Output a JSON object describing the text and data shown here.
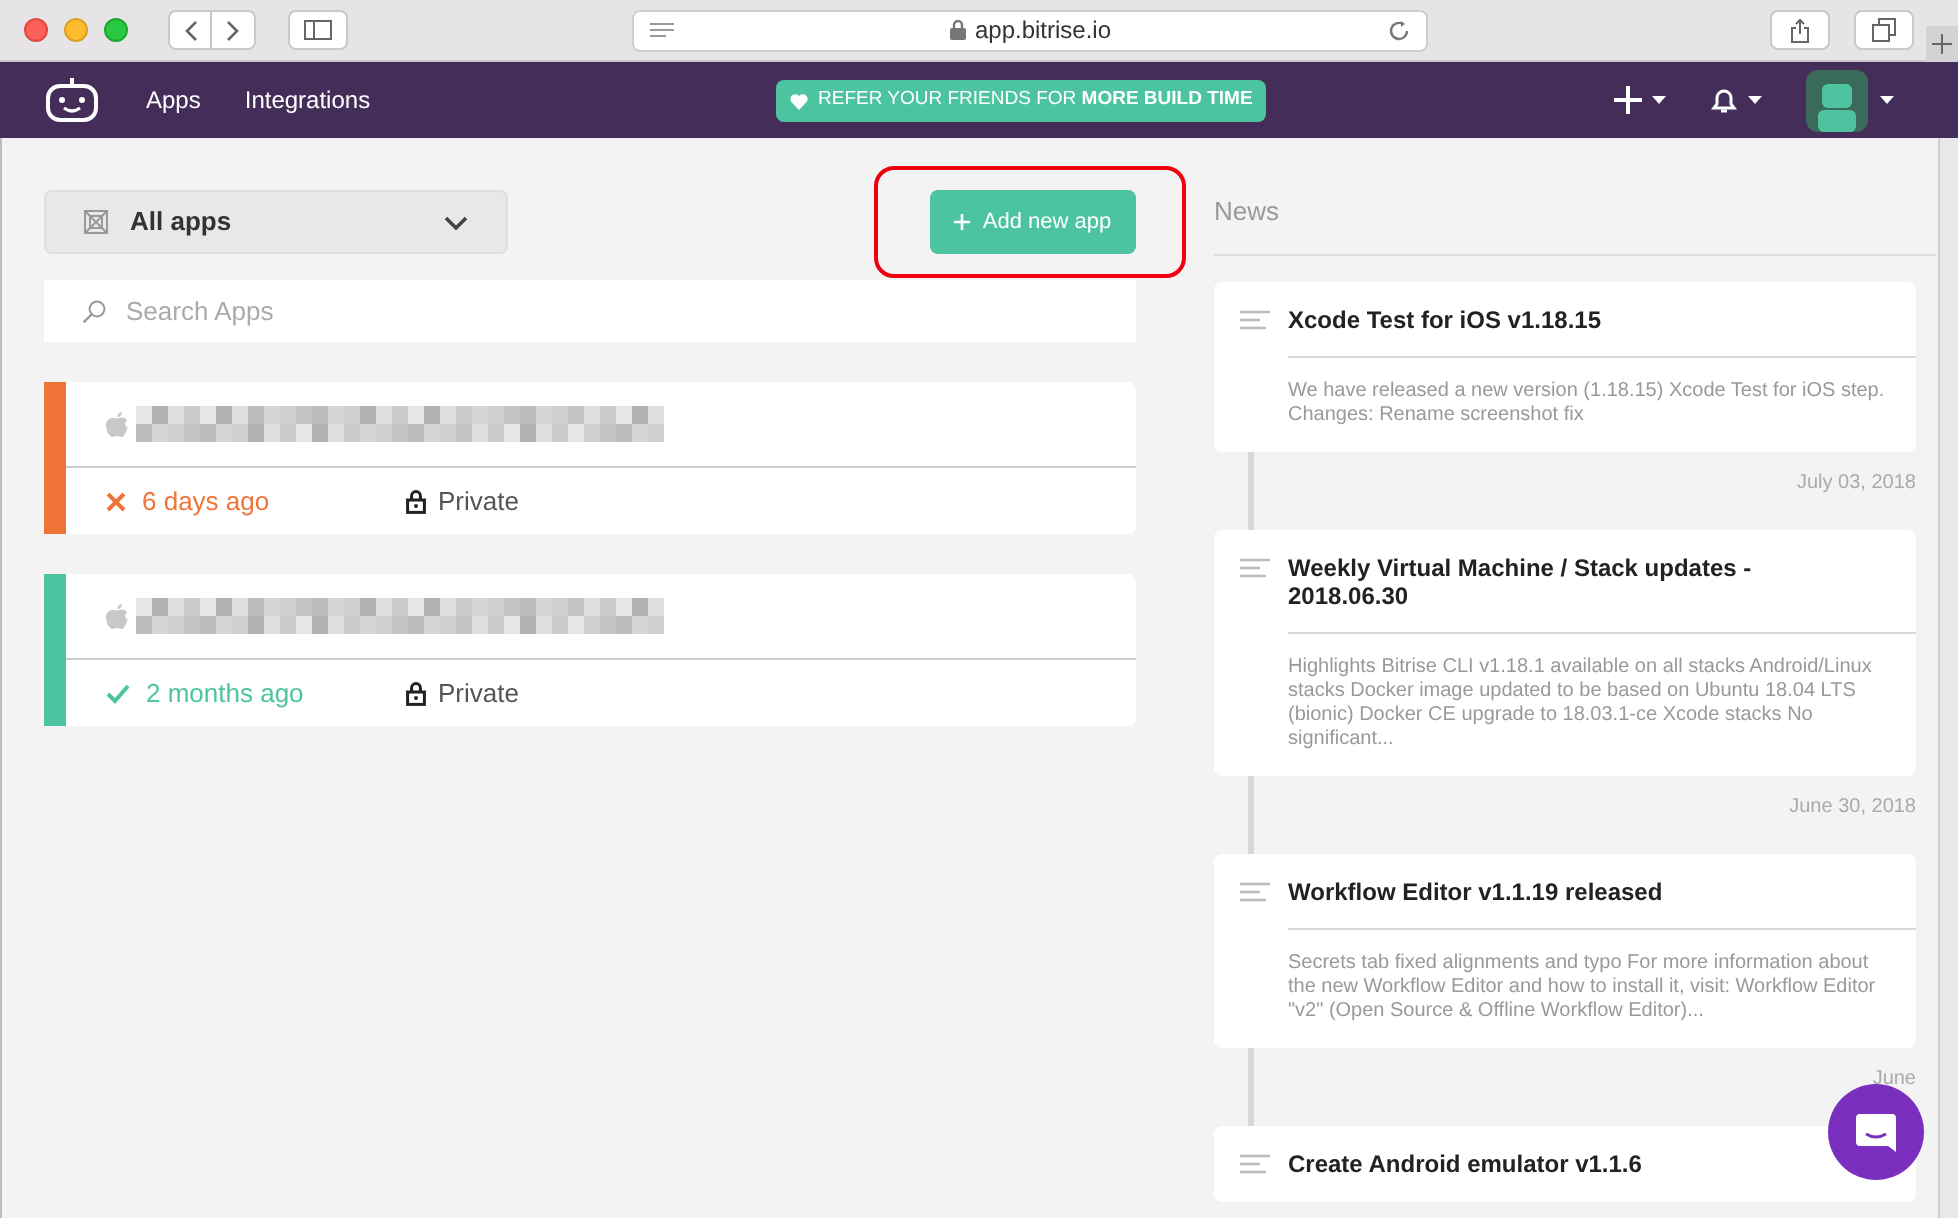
{
  "browser": {
    "url": "app.bitrise.io"
  },
  "nav": {
    "links": [
      "Apps",
      "Integrations"
    ],
    "promo": {
      "text": "REFER YOUR FRIENDS FOR **MORE BUILD TIME**"
    }
  },
  "filter": {
    "label": "All apps"
  },
  "add_button": {
    "label": "Add new app"
  },
  "search": {
    "placeholder": "Search Apps"
  },
  "apps": [
    {
      "kind": "failed",
      "last_build": "6 days ago",
      "visibility": "Private"
    },
    {
      "kind": "success",
      "last_build": "2 months ago",
      "visibility": "Private"
    }
  ],
  "news": {
    "title": "News",
    "items": [
      {
        "title": "Xcode Test for iOS v1.18.15",
        "body": "We have released a new version (1.18.15) Xcode Test for iOS step. Changes: Rename screenshot fix",
        "date": "July 03, 2018"
      },
      {
        "title": "Weekly Virtual Machine / Stack updates - 2018.06.30",
        "body": "Highlights Bitrise CLI v1.18.1 available on all stacks Android/Linux stacks Docker image updated to be based on Ubuntu 18.04 LTS (bionic) Docker CE upgrade to 18.03.1-ce Xcode stacks No significant...",
        "date": "June 30, 2018"
      },
      {
        "title": "Workflow Editor v1.1.19 released",
        "body": "Secrets tab fixed alignments and typo For more information about the new Workflow Editor and how to install it, visit: Workflow Editor \"v2\" (Open Source & Offline Workflow Editor)...",
        "date": "June"
      },
      {
        "title": "Create Android emulator v1.1.6"
      }
    ]
  }
}
